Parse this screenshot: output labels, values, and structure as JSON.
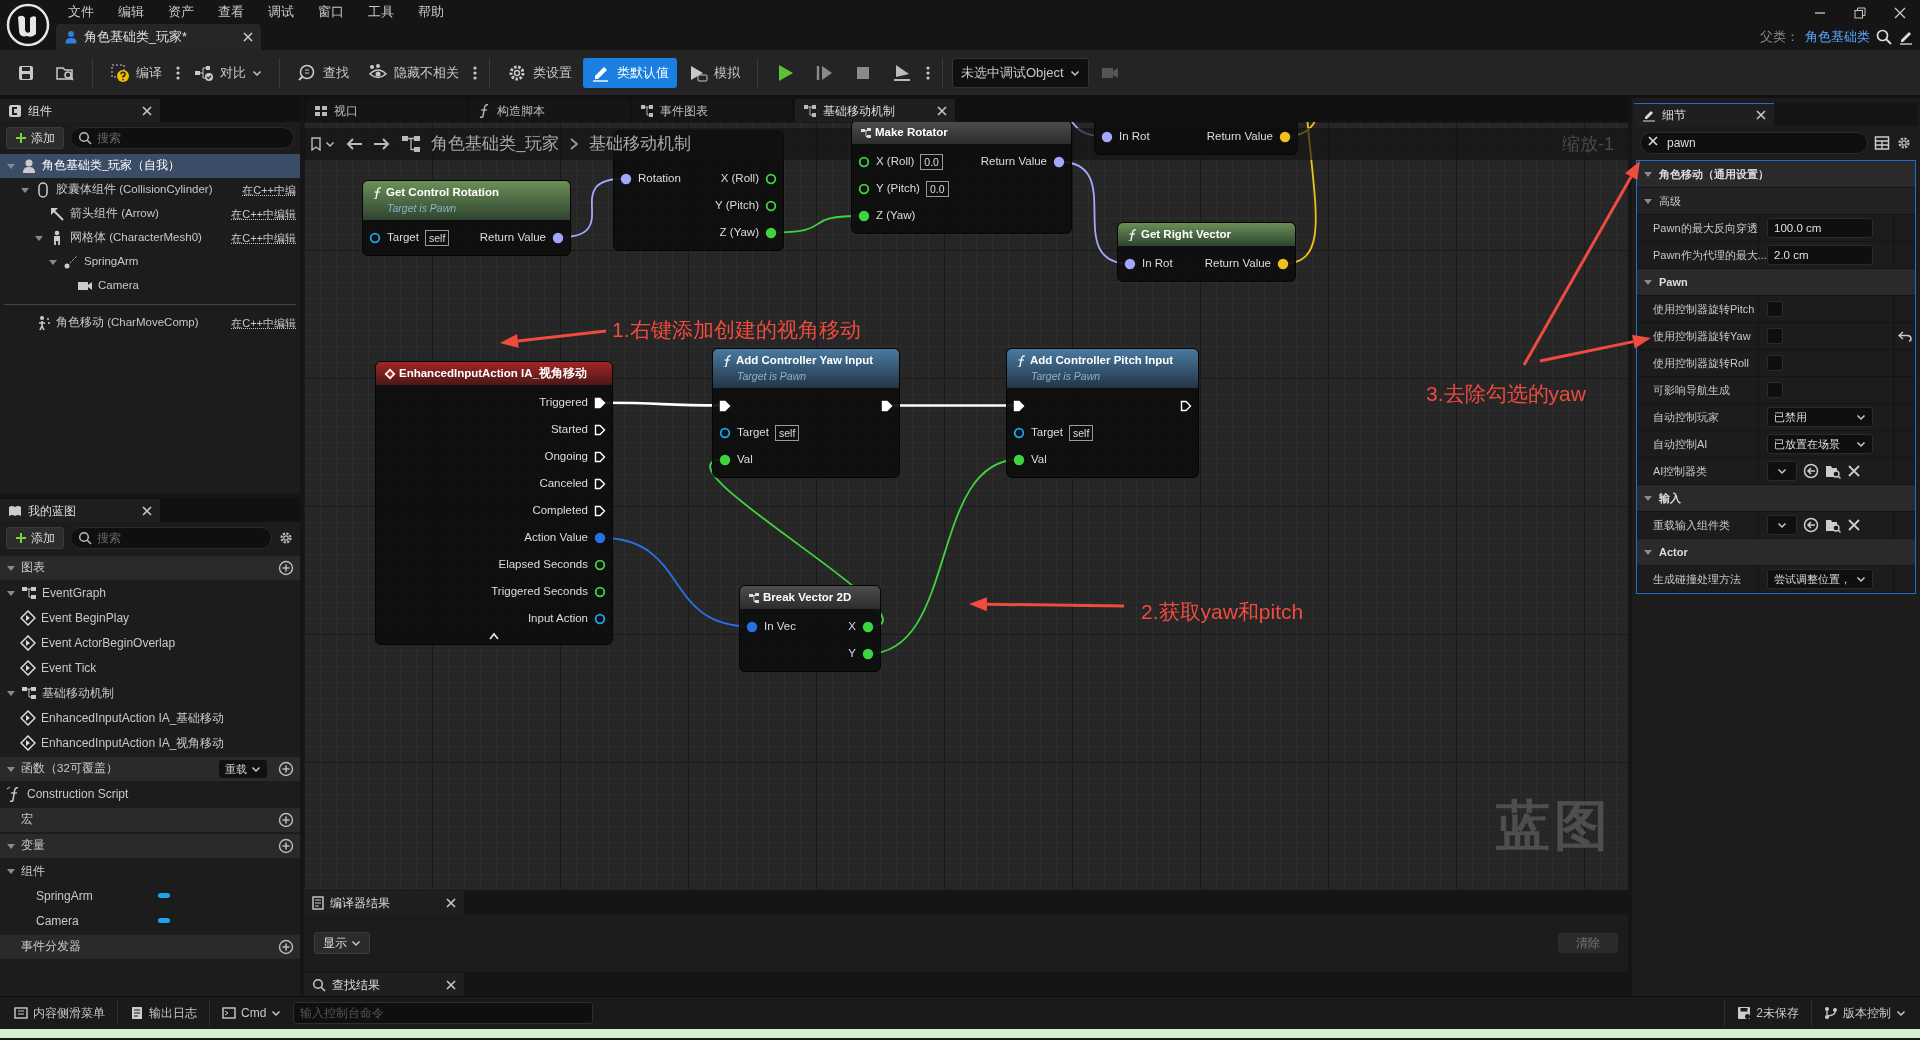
{
  "window": {
    "menu": [
      "文件",
      "编辑",
      "资产",
      "查看",
      "调试",
      "窗口",
      "工具",
      "帮助"
    ],
    "document_tab": {
      "title": "角色基础类_玩家*",
      "selected": true
    },
    "parent_class_label": "父类：",
    "parent_class": "角色基础类"
  },
  "toolbar": [
    {
      "kind": "icon",
      "selected": false
    },
    {
      "kind": "icon",
      "selected": false
    },
    {
      "kind": "button",
      "label": "编译",
      "selected": false
    },
    {
      "kind": "more",
      "selected": false
    },
    {
      "kind": "dropdown",
      "label": "对比",
      "selected": false
    },
    {
      "kind": "button",
      "label": "查找",
      "selected": false
    },
    {
      "kind": "button",
      "label": "隐藏不相关",
      "selected": false
    },
    {
      "kind": "more",
      "selected": false
    },
    {
      "kind": "button",
      "label": "类设置",
      "selected": false
    },
    {
      "kind": "button",
      "label": "类默认值",
      "selected": true
    },
    {
      "kind": "button",
      "label": "模拟",
      "selected": false
    },
    {
      "kind": "icon",
      "selected": false
    },
    {
      "kind": "icon",
      "selected": false
    },
    {
      "kind": "icon",
      "selected": false
    },
    {
      "kind": "icon",
      "selected": false
    },
    {
      "kind": "more",
      "selected": false
    },
    {
      "kind": "select",
      "label": "未选中调试Object",
      "selected": false
    },
    {
      "kind": "icon",
      "selected": false
    }
  ],
  "components_panel": {
    "title": "组件",
    "add_button": "添加",
    "search_placeholder": "搜索",
    "tree": [
      {
        "kind": "root",
        "label": "角色基础类_玩家（自我）",
        "selected": true,
        "expanded": true,
        "children": [
          {
            "kind": "capsule",
            "label": "胶囊体组件 (CollisionCylinder)",
            "note": "在C++中编",
            "selected": false,
            "expanded": true,
            "children": [
              {
                "kind": "arrow",
                "label": "箭头组件 (Arrow)",
                "note": "在C++中编辑",
                "selected": false
              },
              {
                "kind": "mesh",
                "label": "网格体 (CharacterMesh0)",
                "note": "在C++中编辑",
                "selected": false,
                "expanded": true,
                "children": [
                  {
                    "kind": "springarm",
                    "label": "SpringArm",
                    "selected": false,
                    "expanded": true,
                    "children": [
                      {
                        "kind": "camera",
                        "label": "Camera",
                        "selected": false
                      }
                    ]
                  }
                ]
              }
            ]
          }
        ]
      }
    ],
    "other_components": [
      {
        "kind": "movement",
        "label": "角色移动 (CharMoveComp)",
        "note": "在C++中编辑",
        "selected": false
      }
    ]
  },
  "my_blueprint": {
    "title": "我的蓝图",
    "add_button": "添加",
    "search_placeholder": "搜索",
    "sections": [
      {
        "title": "图表",
        "expanded": true,
        "items": [
          {
            "kind": "graph",
            "label": "EventGraph",
            "expanded": true,
            "children": [
              {
                "kind": "event",
                "label": "Event BeginPlay"
              },
              {
                "kind": "event",
                "label": "Event ActorBeginOverlap"
              },
              {
                "kind": "event",
                "label": "Event Tick"
              }
            ]
          },
          {
            "kind": "graph",
            "label": "基础移动机制",
            "expanded": true,
            "children": [
              {
                "kind": "event",
                "label": "EnhancedInputAction IA_基础移动"
              },
              {
                "kind": "event",
                "label": "EnhancedInputAction IA_视角移动"
              }
            ]
          }
        ]
      },
      {
        "title": "函数（32可覆盖）",
        "expanded": true,
        "override_button": "重载",
        "items": [
          {
            "kind": "function",
            "label": "Construction Script"
          }
        ]
      },
      {
        "title": "宏"
      },
      {
        "title": "变量",
        "expanded": true,
        "items": [
          {
            "kind": "category",
            "label": "组件",
            "expanded": true,
            "children": [
              {
                "kind": "variable",
                "label": "SpringArm",
                "color": "#1aa3f0"
              },
              {
                "kind": "variable",
                "label": "Camera",
                "color": "#1aa3f0"
              }
            ]
          }
        ]
      },
      {
        "title": "事件分发器"
      }
    ]
  },
  "graph": {
    "tabs": [
      {
        "label": "视口",
        "selected": false
      },
      {
        "label": "构造脚本",
        "selected": false
      },
      {
        "label": "事件图表",
        "selected": false
      },
      {
        "label": "基础移动机制",
        "selected": true
      }
    ],
    "breadcrumb": [
      "角色基础类_玩家",
      "基础移动机制"
    ],
    "zoom": "缩放-1",
    "graph_type": "蓝图",
    "nodes": [
      {
        "kind": "pure",
        "title": "Get Control Rotation",
        "subtitle": "Target is Pawn",
        "inputs": [
          {
            "kind": "data",
            "color": "#1aa3f0",
            "label": "Target",
            "default": "self",
            "connected": false
          }
        ],
        "outputs": [
          {
            "kind": "data",
            "color": "#a3a7ff",
            "label": "Return Value",
            "connected": true
          }
        ]
      },
      {
        "kind": "headless",
        "inputs": [
          {
            "kind": "data",
            "color": "#a3a7ff",
            "label": "Rotation",
            "connected": true
          }
        ],
        "outputs": [
          {
            "kind": "data",
            "color": "#3fd43f",
            "label": "X (Roll)",
            "connected": false
          },
          {
            "kind": "data",
            "color": "#3fd43f",
            "label": "Y (Pitch)",
            "connected": false
          },
          {
            "kind": "data",
            "color": "#3fd43f",
            "label": "Z (Yaw)",
            "connected": true
          }
        ]
      },
      {
        "kind": "struct",
        "title": "Make Rotator",
        "inputs": [
          {
            "kind": "data",
            "color": "#3fd43f",
            "label": "X (Roll)",
            "default": "0.0",
            "connected": false
          },
          {
            "kind": "data",
            "color": "#3fd43f",
            "label": "Y (Pitch)",
            "default": "0.0",
            "connected": false
          },
          {
            "kind": "data",
            "color": "#3fd43f",
            "label": "Z (Yaw)",
            "connected": true
          }
        ],
        "outputs": [
          {
            "kind": "data",
            "color": "#a3a7ff",
            "label": "Return Value",
            "connected": true
          }
        ]
      },
      {
        "kind": "headless",
        "inputs": [
          {
            "kind": "data",
            "color": "#a3a7ff",
            "label": "In Rot",
            "connected": true
          }
        ],
        "outputs": [
          {
            "kind": "data",
            "color": "#f0c020",
            "label": "Return Value",
            "connected": true
          }
        ]
      },
      {
        "kind": "pure",
        "title": "Get Right Vector",
        "inputs": [
          {
            "kind": "data",
            "color": "#a3a7ff",
            "label": "In Rot",
            "connected": true
          }
        ],
        "outputs": [
          {
            "kind": "data",
            "color": "#f0c020",
            "label": "Return Value",
            "connected": true
          }
        ]
      },
      {
        "kind": "event",
        "title": "EnhancedInputAction IA_视角移动",
        "advanced_expanded": true,
        "outputs": [
          {
            "kind": "exec",
            "label": "Triggered",
            "connected": true
          },
          {
            "kind": "exec",
            "label": "Started",
            "connected": false
          },
          {
            "kind": "exec",
            "label": "Ongoing",
            "connected": false
          },
          {
            "kind": "exec",
            "label": "Canceled",
            "connected": false
          },
          {
            "kind": "exec",
            "label": "Completed",
            "connected": false
          },
          {
            "kind": "data",
            "color": "#2770e6",
            "label": "Action Value",
            "connected": true
          },
          {
            "kind": "data",
            "color": "#3fd43f",
            "label": "Elapsed Seconds",
            "connected": false
          },
          {
            "kind": "data",
            "color": "#3fd43f",
            "label": "Triggered Seconds",
            "connected": false
          },
          {
            "kind": "data",
            "color": "#1aa3f0",
            "label": "Input Action",
            "connected": false
          }
        ]
      },
      {
        "kind": "impure",
        "title": "Add Controller Yaw Input",
        "subtitle": "Target is Pawn",
        "inputs": [
          {
            "kind": "exec",
            "connected": true
          },
          {
            "kind": "data",
            "color": "#1aa3f0",
            "label": "Target",
            "default": "self",
            "connected": false
          },
          {
            "kind": "data",
            "color": "#3fd43f",
            "label": "Val",
            "connected": true
          }
        ],
        "outputs": [
          {
            "kind": "exec",
            "connected": true
          }
        ]
      },
      {
        "kind": "impure",
        "title": "Add Controller Pitch Input",
        "subtitle": "Target is Pawn",
        "inputs": [
          {
            "kind": "exec",
            "connected": true
          },
          {
            "kind": "data",
            "color": "#1aa3f0",
            "label": "Target",
            "default": "self",
            "connected": false
          },
          {
            "kind": "data",
            "color": "#3fd43f",
            "label": "Val",
            "connected": true
          }
        ],
        "outputs": [
          {
            "kind": "exec",
            "connected": false
          }
        ]
      },
      {
        "kind": "struct",
        "title": "Break Vector 2D",
        "inputs": [
          {
            "kind": "data",
            "color": "#2770e6",
            "label": "In Vec",
            "connected": true
          }
        ],
        "outputs": [
          {
            "kind": "data",
            "color": "#3fd43f",
            "label": "X",
            "connected": true
          },
          {
            "kind": "data",
            "color": "#3fd43f",
            "label": "Y",
            "connected": true
          }
        ]
      }
    ],
    "annotations": [
      {
        "text": "1.右键添加创建的视角移动"
      },
      {
        "text": "2.获取yaw和pitch"
      },
      {
        "text": "3.去除勾选的yaw"
      }
    ]
  },
  "compiler_results": {
    "title": "编译器结果",
    "show_button": "显示",
    "clear_button": "清除",
    "clear_disabled": true
  },
  "find_results": {
    "title": "查找结果"
  },
  "details": {
    "title": "细节",
    "search": "pawn",
    "rows": [
      {
        "kind": "category",
        "label": "角色移动（通用设置）",
        "expanded": true
      },
      {
        "kind": "subcategory",
        "label": "高级",
        "expanded": true
      },
      {
        "kind": "number",
        "label": "Pawn的最大反向穿透",
        "value": "100.0 cm"
      },
      {
        "kind": "number",
        "label": "Pawn作为代理的最大...",
        "value": "2.0 cm"
      },
      {
        "kind": "category",
        "label": "Pawn",
        "expanded": true
      },
      {
        "kind": "checkbox",
        "label": "使用控制器旋转Pitch",
        "checked": false,
        "modified": false
      },
      {
        "kind": "checkbox",
        "label": "使用控制器旋转Yaw",
        "checked": false,
        "modified": true
      },
      {
        "kind": "checkbox",
        "label": "使用控制器旋转Roll",
        "checked": false,
        "modified": false
      },
      {
        "kind": "checkbox",
        "label": "可影响导航生成",
        "checked": false,
        "modified": false
      },
      {
        "kind": "dropdown",
        "label": "自动控制玩家",
        "value": "已禁用"
      },
      {
        "kind": "dropdown",
        "label": "自动控制AI",
        "value": "已放置在场景"
      },
      {
        "kind": "class",
        "label": "AI控制器类"
      },
      {
        "kind": "category",
        "label": "输入",
        "expanded": true
      },
      {
        "kind": "class",
        "label": "重载输入组件类"
      },
      {
        "kind": "category",
        "label": "Actor",
        "expanded": true
      },
      {
        "kind": "dropdown",
        "label": "生成碰撞处理方法",
        "value": "尝试调整位置，"
      }
    ]
  },
  "status_bar": {
    "content_drawer": "内容侧滑菜单",
    "output_log": "输出日志",
    "cmd": "Cmd",
    "console_placeholder": "输入控制台命令",
    "unsaved": "2未保存",
    "source_control": "版本控制"
  }
}
